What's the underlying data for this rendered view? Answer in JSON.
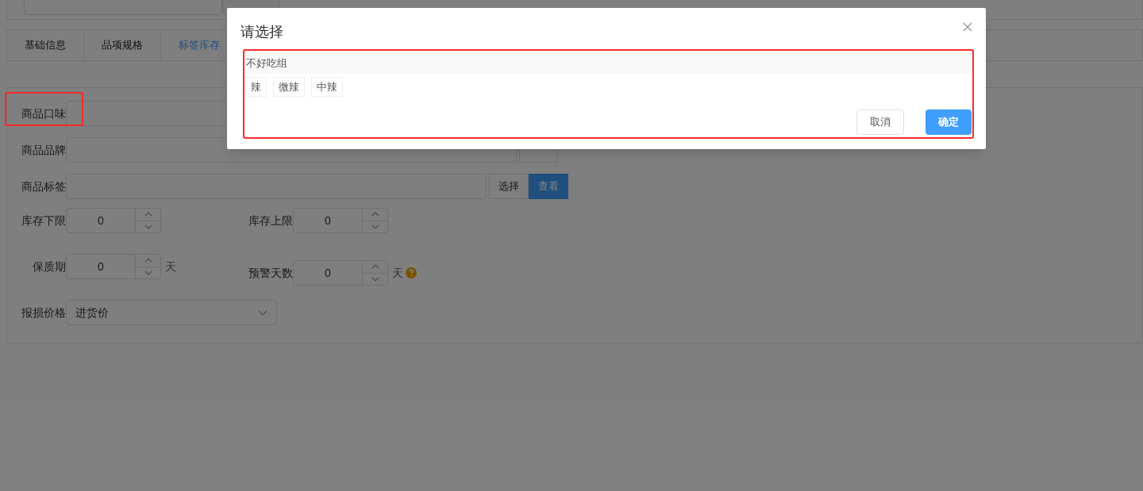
{
  "tabs": [
    {
      "label": "基础信息",
      "selected": false
    },
    {
      "label": "品项规格",
      "selected": false
    },
    {
      "label": "标签库存",
      "selected": true
    }
  ],
  "fields": [
    {
      "kind": "text",
      "label": "商品口味"
    },
    {
      "kind": "picker",
      "label": "商品品牌",
      "buttons": [
        {
          "primary": false
        }
      ]
    },
    {
      "kind": "picker",
      "label": "商品标签",
      "buttons": [
        {
          "label": "选择",
          "primary": false
        },
        {
          "label": "查看",
          "primary": true
        }
      ]
    }
  ],
  "number_rows": [
    [
      {
        "label": "库存下限",
        "value": "0",
        "help": false
      },
      {
        "label": "库存上限",
        "value": "0",
        "help": false
      }
    ],
    [
      {
        "label": "保质期",
        "value": "0",
        "unit": "天",
        "help": false
      },
      {
        "label": "预警天数",
        "value": "0",
        "unit": "天",
        "help": true
      }
    ]
  ],
  "select": {
    "label": "报损价格",
    "value": "进货价"
  },
  "dialog": {
    "title": "请选择",
    "groups": [
      {
        "name": "不好吃组",
        "tags": [
          "辣",
          "微辣",
          "中辣"
        ]
      }
    ],
    "cancel": "取消",
    "confirm": "确定"
  }
}
